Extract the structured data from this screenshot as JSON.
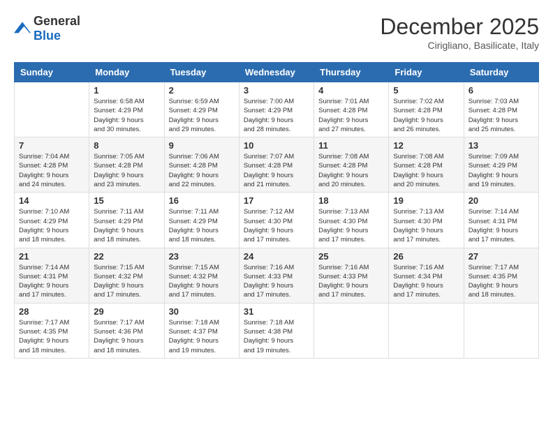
{
  "logo": {
    "general": "General",
    "blue": "Blue"
  },
  "title": "December 2025",
  "subtitle": "Cirigliano, Basilicate, Italy",
  "days_of_week": [
    "Sunday",
    "Monday",
    "Tuesday",
    "Wednesday",
    "Thursday",
    "Friday",
    "Saturday"
  ],
  "weeks": [
    [
      {
        "day": "",
        "info": ""
      },
      {
        "day": "1",
        "info": "Sunrise: 6:58 AM\nSunset: 4:29 PM\nDaylight: 9 hours\nand 30 minutes."
      },
      {
        "day": "2",
        "info": "Sunrise: 6:59 AM\nSunset: 4:29 PM\nDaylight: 9 hours\nand 29 minutes."
      },
      {
        "day": "3",
        "info": "Sunrise: 7:00 AM\nSunset: 4:29 PM\nDaylight: 9 hours\nand 28 minutes."
      },
      {
        "day": "4",
        "info": "Sunrise: 7:01 AM\nSunset: 4:28 PM\nDaylight: 9 hours\nand 27 minutes."
      },
      {
        "day": "5",
        "info": "Sunrise: 7:02 AM\nSunset: 4:28 PM\nDaylight: 9 hours\nand 26 minutes."
      },
      {
        "day": "6",
        "info": "Sunrise: 7:03 AM\nSunset: 4:28 PM\nDaylight: 9 hours\nand 25 minutes."
      }
    ],
    [
      {
        "day": "7",
        "info": "Sunrise: 7:04 AM\nSunset: 4:28 PM\nDaylight: 9 hours\nand 24 minutes."
      },
      {
        "day": "8",
        "info": "Sunrise: 7:05 AM\nSunset: 4:28 PM\nDaylight: 9 hours\nand 23 minutes."
      },
      {
        "day": "9",
        "info": "Sunrise: 7:06 AM\nSunset: 4:28 PM\nDaylight: 9 hours\nand 22 minutes."
      },
      {
        "day": "10",
        "info": "Sunrise: 7:07 AM\nSunset: 4:28 PM\nDaylight: 9 hours\nand 21 minutes."
      },
      {
        "day": "11",
        "info": "Sunrise: 7:08 AM\nSunset: 4:28 PM\nDaylight: 9 hours\nand 20 minutes."
      },
      {
        "day": "12",
        "info": "Sunrise: 7:08 AM\nSunset: 4:28 PM\nDaylight: 9 hours\nand 20 minutes."
      },
      {
        "day": "13",
        "info": "Sunrise: 7:09 AM\nSunset: 4:29 PM\nDaylight: 9 hours\nand 19 minutes."
      }
    ],
    [
      {
        "day": "14",
        "info": "Sunrise: 7:10 AM\nSunset: 4:29 PM\nDaylight: 9 hours\nand 18 minutes."
      },
      {
        "day": "15",
        "info": "Sunrise: 7:11 AM\nSunset: 4:29 PM\nDaylight: 9 hours\nand 18 minutes."
      },
      {
        "day": "16",
        "info": "Sunrise: 7:11 AM\nSunset: 4:29 PM\nDaylight: 9 hours\nand 18 minutes."
      },
      {
        "day": "17",
        "info": "Sunrise: 7:12 AM\nSunset: 4:30 PM\nDaylight: 9 hours\nand 17 minutes."
      },
      {
        "day": "18",
        "info": "Sunrise: 7:13 AM\nSunset: 4:30 PM\nDaylight: 9 hours\nand 17 minutes."
      },
      {
        "day": "19",
        "info": "Sunrise: 7:13 AM\nSunset: 4:30 PM\nDaylight: 9 hours\nand 17 minutes."
      },
      {
        "day": "20",
        "info": "Sunrise: 7:14 AM\nSunset: 4:31 PM\nDaylight: 9 hours\nand 17 minutes."
      }
    ],
    [
      {
        "day": "21",
        "info": "Sunrise: 7:14 AM\nSunset: 4:31 PM\nDaylight: 9 hours\nand 17 minutes."
      },
      {
        "day": "22",
        "info": "Sunrise: 7:15 AM\nSunset: 4:32 PM\nDaylight: 9 hours\nand 17 minutes."
      },
      {
        "day": "23",
        "info": "Sunrise: 7:15 AM\nSunset: 4:32 PM\nDaylight: 9 hours\nand 17 minutes."
      },
      {
        "day": "24",
        "info": "Sunrise: 7:16 AM\nSunset: 4:33 PM\nDaylight: 9 hours\nand 17 minutes."
      },
      {
        "day": "25",
        "info": "Sunrise: 7:16 AM\nSunset: 4:33 PM\nDaylight: 9 hours\nand 17 minutes."
      },
      {
        "day": "26",
        "info": "Sunrise: 7:16 AM\nSunset: 4:34 PM\nDaylight: 9 hours\nand 17 minutes."
      },
      {
        "day": "27",
        "info": "Sunrise: 7:17 AM\nSunset: 4:35 PM\nDaylight: 9 hours\nand 18 minutes."
      }
    ],
    [
      {
        "day": "28",
        "info": "Sunrise: 7:17 AM\nSunset: 4:35 PM\nDaylight: 9 hours\nand 18 minutes."
      },
      {
        "day": "29",
        "info": "Sunrise: 7:17 AM\nSunset: 4:36 PM\nDaylight: 9 hours\nand 18 minutes."
      },
      {
        "day": "30",
        "info": "Sunrise: 7:18 AM\nSunset: 4:37 PM\nDaylight: 9 hours\nand 19 minutes."
      },
      {
        "day": "31",
        "info": "Sunrise: 7:18 AM\nSunset: 4:38 PM\nDaylight: 9 hours\nand 19 minutes."
      },
      {
        "day": "",
        "info": ""
      },
      {
        "day": "",
        "info": ""
      },
      {
        "day": "",
        "info": ""
      }
    ]
  ]
}
